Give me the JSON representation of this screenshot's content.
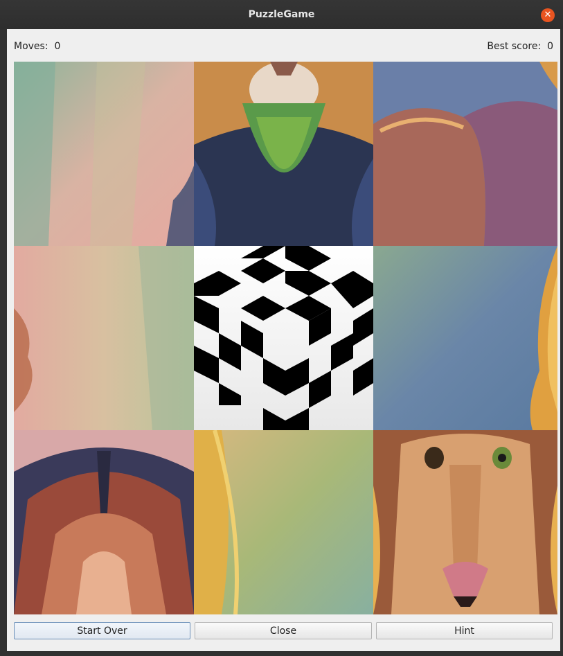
{
  "window": {
    "title": "PuzzleGame",
    "close_icon": "close-icon"
  },
  "status": {
    "moves_label": "Moves:",
    "moves_value": "0",
    "best_label": "Best score:",
    "best_value": "0"
  },
  "board": {
    "rows": 3,
    "cols": 3,
    "empty_tile": {
      "row": 1,
      "col": 1,
      "icon": "cube-pattern-icon"
    },
    "tiles": [
      {
        "name": "tile-abstract-pastel-top-left"
      },
      {
        "name": "tile-lion-beard"
      },
      {
        "name": "tile-lion-shoulder"
      },
      {
        "name": "tile-abstract-pastel-mid-left"
      },
      {
        "name": "tile-empty-cube"
      },
      {
        "name": "tile-abstract-blue-mane-edge"
      },
      {
        "name": "tile-lion-mane-top"
      },
      {
        "name": "tile-abstract-yellow-green"
      },
      {
        "name": "tile-lion-face"
      }
    ]
  },
  "buttons": {
    "start_over": "Start Over",
    "close": "Close",
    "hint": "Hint"
  },
  "colors": {
    "accent": "#e95420",
    "client_bg": "#efefef",
    "titlebar": "#303030"
  }
}
